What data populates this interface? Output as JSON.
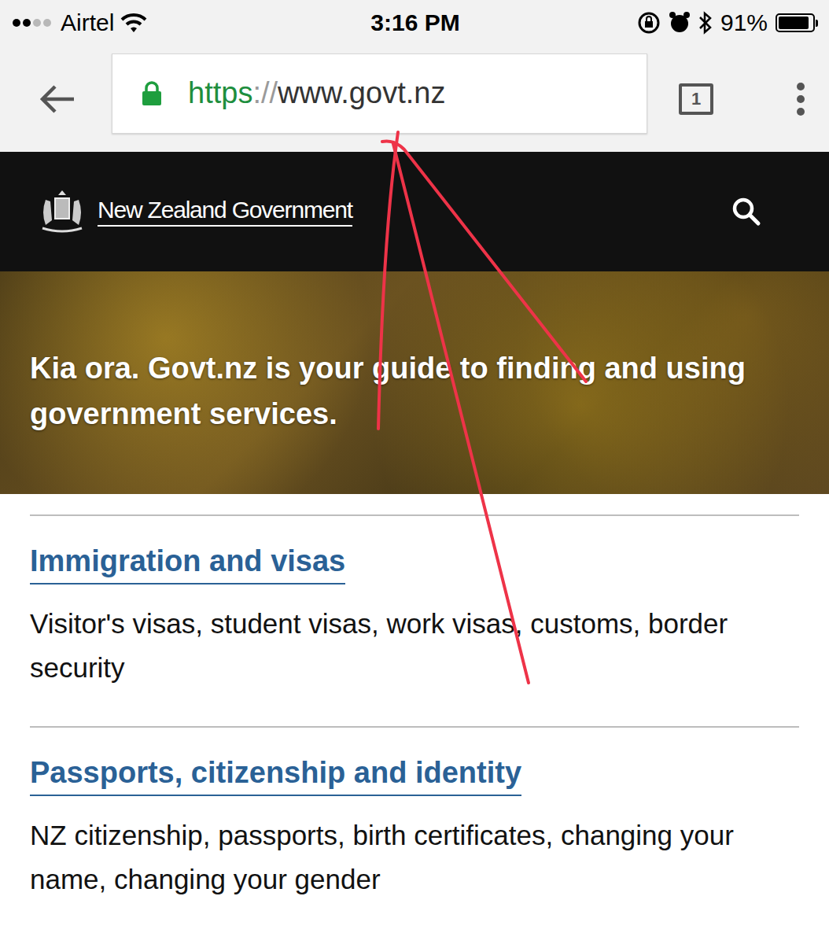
{
  "status_bar": {
    "carrier": "Airtel",
    "signal_level": 0.5,
    "time": "3:16 PM",
    "battery": "91%",
    "battery_level": 0.91
  },
  "browser": {
    "secure": true,
    "scheme": "https",
    "separator": "://",
    "host": "www.govt.nz",
    "tab_count": "1"
  },
  "header": {
    "brand": "New Zealand Government"
  },
  "hero": {
    "text": "Kia ora. Govt.nz is your guide to finding and using government services."
  },
  "sections": [
    {
      "title": "Immigration and visas",
      "description": "Visitor's visas, student visas, work visas, customs, border security"
    },
    {
      "title": "Passports, citizenship and identity",
      "description": "NZ citizenship, passports, birth certificates, changing your name, changing your gender"
    }
  ]
}
